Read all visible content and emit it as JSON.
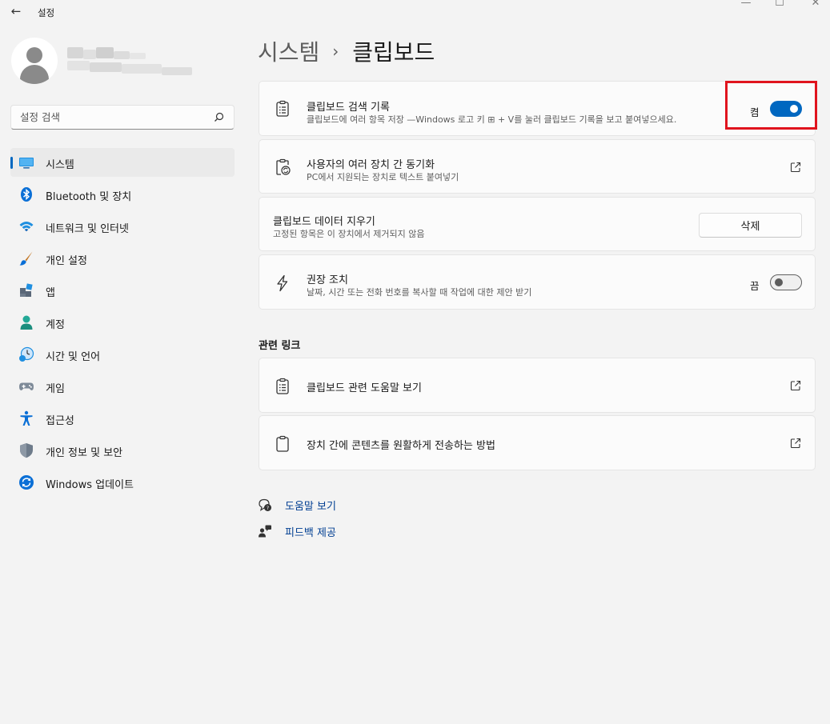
{
  "window": {
    "title": "설정",
    "back_glyph": "←",
    "min_glyph": "—",
    "max_glyph": "☐",
    "close_glyph": "✕"
  },
  "search": {
    "placeholder": "설정 검색"
  },
  "nav": {
    "items": [
      {
        "label": "시스템",
        "icon": "system-icon",
        "active": true
      },
      {
        "label": "Bluetooth 및 장치",
        "icon": "bluetooth-icon"
      },
      {
        "label": "네트워크 및 인터넷",
        "icon": "wifi-icon"
      },
      {
        "label": "개인 설정",
        "icon": "brush-icon"
      },
      {
        "label": "앱",
        "icon": "apps-icon"
      },
      {
        "label": "계정",
        "icon": "account-icon"
      },
      {
        "label": "시간 및 언어",
        "icon": "time-language-icon"
      },
      {
        "label": "게임",
        "icon": "gamepad-icon"
      },
      {
        "label": "접근성",
        "icon": "accessibility-icon"
      },
      {
        "label": "개인 정보 및 보안",
        "icon": "shield-icon"
      },
      {
        "label": "Windows 업데이트",
        "icon": "update-icon"
      }
    ]
  },
  "page": {
    "breadcrumb_parent": "시스템",
    "breadcrumb_sep": "›",
    "breadcrumb_current": "클립보드"
  },
  "settings": {
    "history": {
      "title": "클립보드 검색 기록",
      "subtitle": "클립보드에 여러 항목 저장 —Windows 로고 키 ⊞ + V를 눌러 클립보드 기록을 보고 붙여넣으세요.",
      "state": "켬",
      "on": true
    },
    "sync": {
      "title": "사용자의 여러 장치 간 동기화",
      "subtitle": "PC에서 지원되는 장치로 텍스트 붙여넣기"
    },
    "clear": {
      "title": "클립보드 데이터 지우기",
      "subtitle": "고정된 항목은 이 장치에서 제거되지 않음",
      "button": "삭제"
    },
    "suggested": {
      "title": "권장 조치",
      "subtitle": "날짜, 시간 또는 전화 번호를 복사할 때 작업에 대한 제안 받기",
      "state": "끔",
      "on": false
    }
  },
  "related": {
    "heading": "관련 링크",
    "links": [
      {
        "label": "클립보드 관련 도움말 보기"
      },
      {
        "label": "장치 간에 콘텐츠를 원활하게 전송하는 방법"
      }
    ]
  },
  "footer": {
    "help": "도움말 보기",
    "feedback": "피드백 제공"
  },
  "colors": {
    "accent": "#0067c0",
    "highlight": "#e0141e",
    "link": "#003e92"
  }
}
